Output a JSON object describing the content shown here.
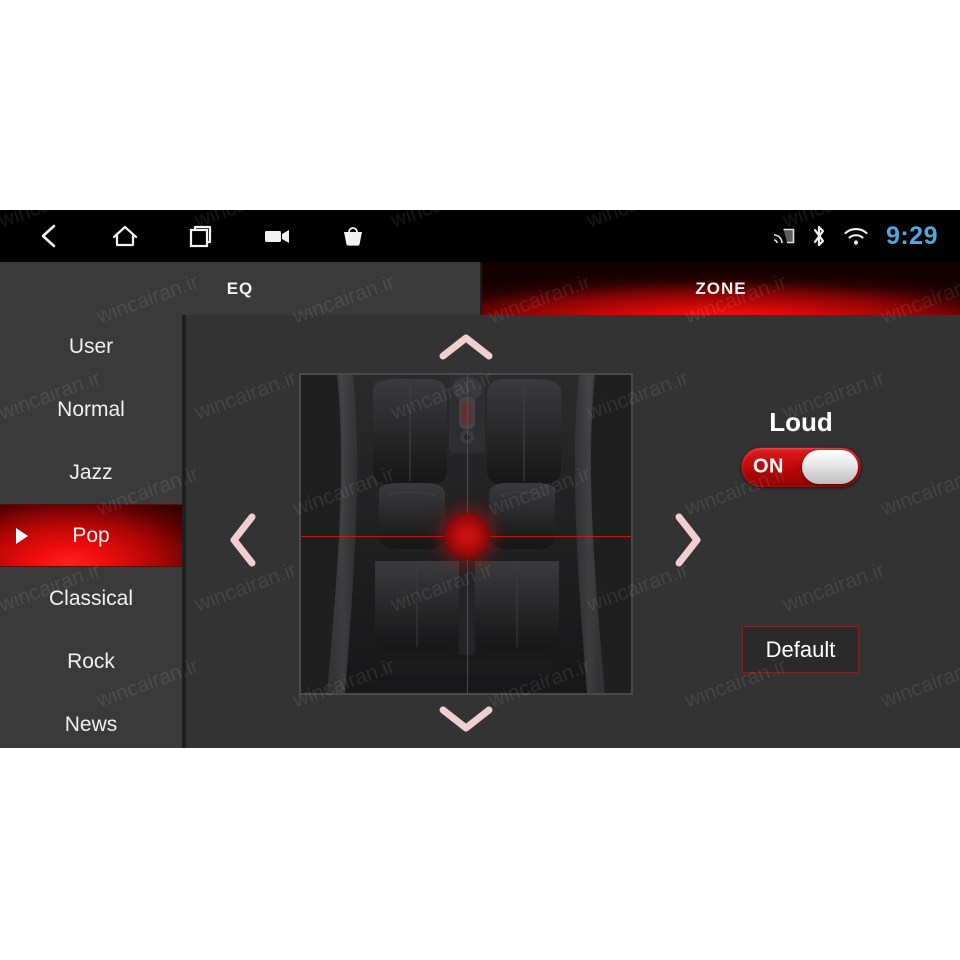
{
  "statusbar": {
    "nav_icons": [
      {
        "name": "back-icon",
        "label": "Back"
      },
      {
        "name": "home-icon",
        "label": "Home"
      },
      {
        "name": "recents-icon",
        "label": "Recent apps"
      },
      {
        "name": "video-camera-icon",
        "label": "Screen record"
      },
      {
        "name": "shopping-bag-icon",
        "label": "Apps"
      }
    ],
    "system_icons": [
      {
        "name": "cast-icon",
        "label": "Cast"
      },
      {
        "name": "bluetooth-icon",
        "label": "Bluetooth"
      },
      {
        "name": "wifi-icon",
        "label": "Wi-Fi"
      }
    ],
    "clock": "9:29",
    "clock_color": "#4fa8dd"
  },
  "tabs": [
    {
      "id": "eq",
      "label": "EQ",
      "active": false
    },
    {
      "id": "zone",
      "label": "ZONE",
      "active": true
    }
  ],
  "presets": [
    {
      "label": "User",
      "selected": false
    },
    {
      "label": "Normal",
      "selected": false
    },
    {
      "label": "Jazz",
      "selected": false
    },
    {
      "label": "Pop",
      "selected": true
    },
    {
      "label": "Classical",
      "selected": false
    },
    {
      "label": "Rock",
      "selected": false
    },
    {
      "label": "News",
      "selected": false
    }
  ],
  "zone": {
    "arrows": {
      "up": "chevron-up-icon",
      "down": "chevron-down-icon",
      "left": "chevron-left-icon",
      "right": "chevron-right-icon"
    },
    "position_label": "center",
    "image_alt": "Car interior top view with four seats"
  },
  "controls": {
    "loud_label": "Loud",
    "loud_state": "ON",
    "default_label": "Default"
  },
  "colors": {
    "accent_red": "#e00808",
    "screen_bg": "#333333",
    "panel_bg": "#3a3a3a",
    "statusbar_bg": "#010101",
    "clock_blue": "#4fa8dd"
  },
  "watermark": {
    "text": "wincairan.ir"
  }
}
